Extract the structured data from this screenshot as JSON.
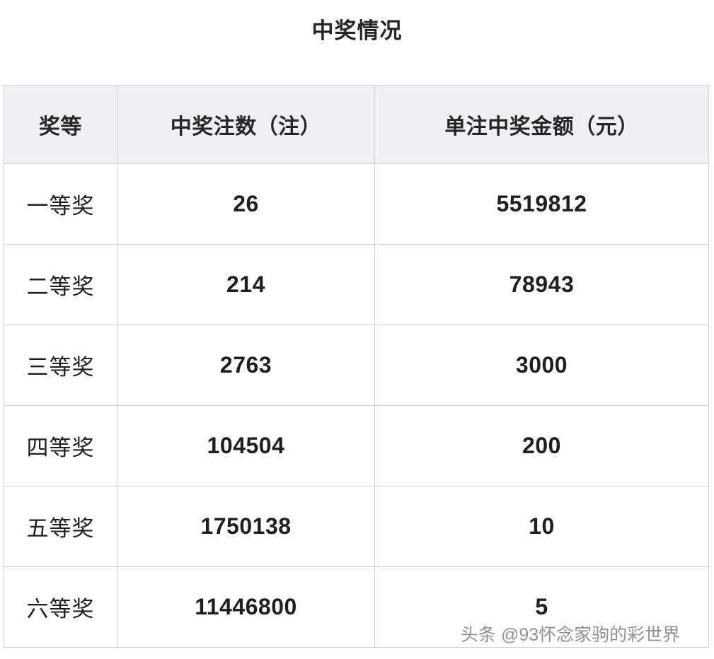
{
  "title": "中奖情况",
  "table": {
    "columns": [
      "奖等",
      "中奖注数（注）",
      "单注中奖金额（元）"
    ],
    "rows": [
      {
        "grade": "一等奖",
        "count": "26",
        "amount": "5519812"
      },
      {
        "grade": "二等奖",
        "count": "214",
        "amount": "78943"
      },
      {
        "grade": "三等奖",
        "count": "2763",
        "amount": "3000"
      },
      {
        "grade": "四等奖",
        "count": "104504",
        "amount": "200"
      },
      {
        "grade": "五等奖",
        "count": "1750138",
        "amount": "10"
      },
      {
        "grade": "六等奖",
        "count": "11446800",
        "amount": "5"
      }
    ]
  },
  "watermark": "头条 @93怀念家驹的彩世界",
  "colors": {
    "page_background": "#ffffff",
    "header_fill": "#f0f0f4",
    "border": "#d2d2d6",
    "text": "#1f1f1f",
    "watermark_text": "#7a7a7a"
  }
}
